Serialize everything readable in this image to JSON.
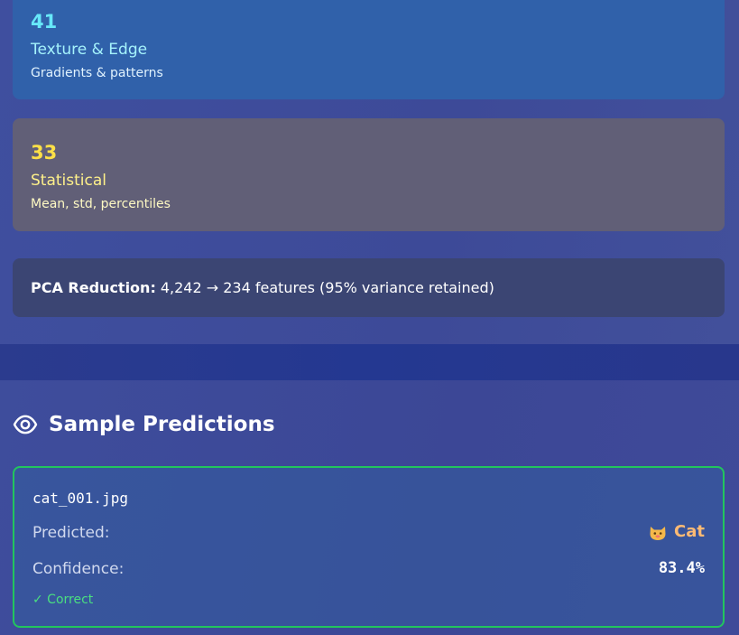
{
  "feature_cards": {
    "texture": {
      "count": "41",
      "title": "Texture & Edge",
      "description": "Gradients & patterns"
    },
    "statistical": {
      "count": "33",
      "title": "Statistical",
      "description": "Mean, std, percentiles"
    }
  },
  "pca": {
    "label": "PCA Reduction:",
    "text": "4,242 → 234 features (95% variance retained)"
  },
  "predictions": {
    "section_title": "Sample Predictions",
    "section_icon": "eye-icon",
    "items": [
      {
        "filename": "cat_001.jpg",
        "predicted_label": "Predicted:",
        "predicted_icon": "cat-face-icon",
        "predicted_value": "Cat",
        "confidence_label": "Confidence:",
        "confidence_value": "83.4%",
        "status": "✓ Correct"
      }
    ]
  },
  "colors": {
    "texture_accent": "#67e8f9",
    "statistical_accent": "#fde047",
    "correct_border": "#22c55e",
    "predicted_accent": "#fdba74"
  }
}
